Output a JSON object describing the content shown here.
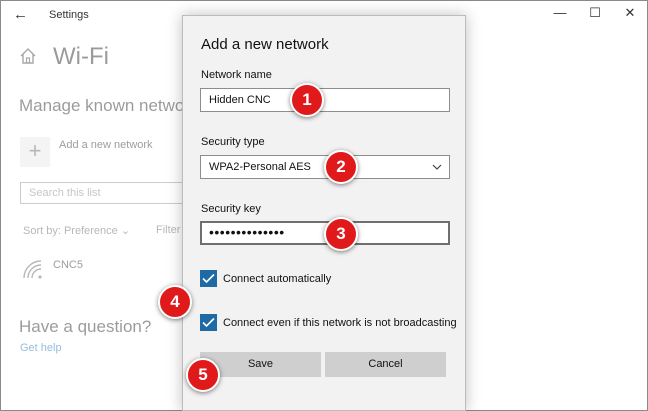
{
  "window": {
    "app_title": "Settings",
    "back_icon": "back-arrow-icon",
    "controls": {
      "minimize": "—",
      "maximize": "☐",
      "close": "✕"
    }
  },
  "background": {
    "page_title": "Wi-Fi",
    "section_title": "Manage known network",
    "add_network_label": "Add a new network",
    "add_icon": "+",
    "search_placeholder": "Search this list",
    "sort_label": "Sort by: Preference",
    "filter_label": "Filter",
    "known_network": "CNC5",
    "question_title": "Have a question?",
    "help_link": "Get help"
  },
  "dialog": {
    "title": "Add a new network",
    "network_name_label": "Network name",
    "network_name_value": "Hidden CNC",
    "security_type_label": "Security type",
    "security_type_value": "WPA2-Personal AES",
    "security_key_label": "Security key",
    "security_key_value": "••••••••••••••",
    "connect_auto_label": "Connect automatically",
    "connect_auto_checked": true,
    "connect_hidden_label": "Connect even if this network is not broadcasting",
    "connect_hidden_checked": true,
    "save_label": "Save",
    "cancel_label": "Cancel"
  },
  "badges": [
    "1",
    "2",
    "3",
    "4",
    "5"
  ],
  "colors": {
    "accent": "#1f6aa5",
    "badge": "#e0191b",
    "link": "#0063b1"
  }
}
